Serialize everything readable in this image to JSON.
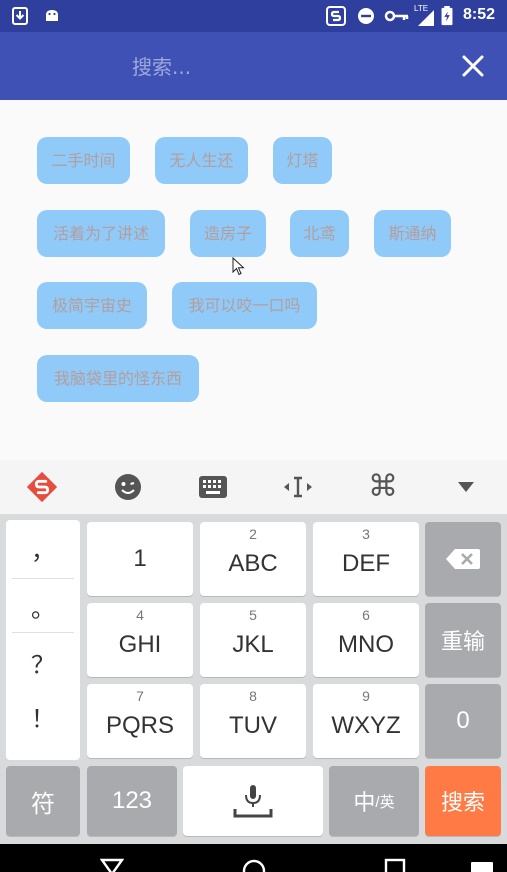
{
  "status_bar": {
    "time": "8:52",
    "network": "LTE"
  },
  "app_bar": {
    "search_placeholder": "搜索...",
    "close_icon": "close-icon"
  },
  "tags": [
    {
      "label": "二手时间"
    },
    {
      "label": "无人生还"
    },
    {
      "label": "灯塔"
    },
    {
      "label": "活着为了讲述"
    },
    {
      "label": "造房子"
    },
    {
      "label": "北鸢"
    },
    {
      "label": "斯通纳"
    },
    {
      "label": "极简宇宙史"
    },
    {
      "label": "我可以咬一口吗"
    },
    {
      "label": "我脑袋里的怪东西"
    }
  ],
  "keyboard": {
    "punctuation": [
      "，",
      "。",
      "？",
      "！"
    ],
    "keys": {
      "k1": {
        "main": "1"
      },
      "k2": {
        "sub": "2",
        "main": "ABC"
      },
      "k3": {
        "sub": "3",
        "main": "DEF"
      },
      "k4": {
        "sub": "4",
        "main": "GHI"
      },
      "k5": {
        "sub": "5",
        "main": "JKL"
      },
      "k6": {
        "sub": "6",
        "main": "MNO"
      },
      "k7": {
        "sub": "7",
        "main": "PQRS"
      },
      "k8": {
        "sub": "8",
        "main": "TUV"
      },
      "k9": {
        "sub": "9",
        "main": "WXYZ"
      },
      "k0": {
        "main": "0"
      }
    },
    "reenter_label": "重输",
    "symbols_label": "符",
    "numbers_label": "123",
    "lang_main": "中",
    "lang_sub": "/英",
    "search_label": "搜索"
  },
  "colors": {
    "appbar": "#3f51b5",
    "statusbar": "#2f3f9e",
    "tag_bg": "#90caf9",
    "search_key": "#ff7a45"
  }
}
